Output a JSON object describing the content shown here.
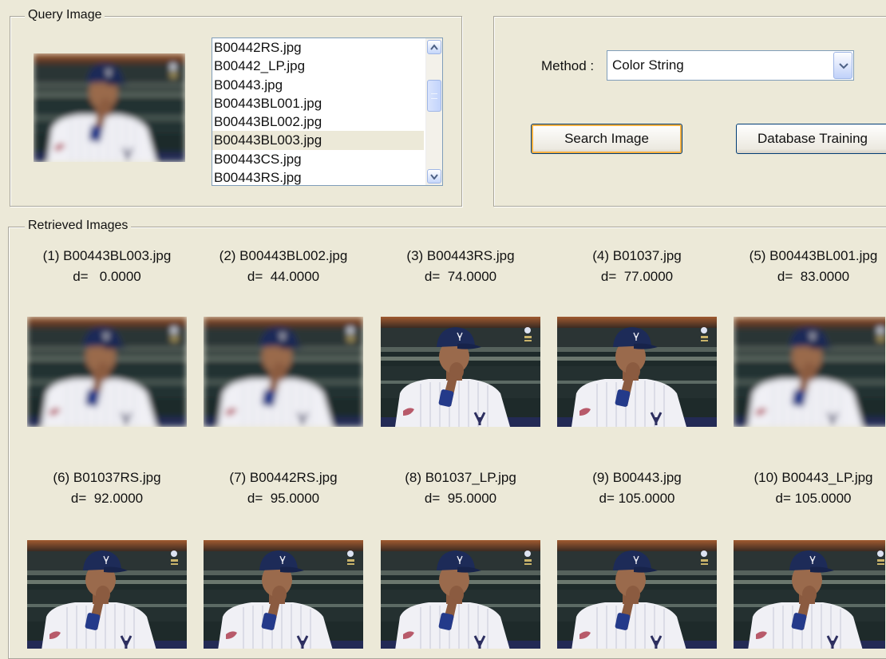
{
  "query_group": {
    "legend": "Query Image",
    "file_list": [
      "B00442RS.jpg",
      "B00442_LP.jpg",
      "B00443.jpg",
      "B00443BL001.jpg",
      "B00443BL002.jpg",
      "B00443BL003.jpg",
      "B00443CS.jpg",
      "B00443RS.jpg"
    ],
    "selected_file": "B00443BL003.jpg"
  },
  "controls": {
    "method_label": "Method :",
    "method_value": "Color String",
    "search_button": "Search Image",
    "training_button": "Database Training"
  },
  "results_group": {
    "legend": "Retrieved Images",
    "items": [
      {
        "title": "(1) B00443BL003.jpg",
        "distance": "d=   0.0000",
        "blurred": true
      },
      {
        "title": "(2) B00443BL002.jpg",
        "distance": "d=  44.0000",
        "blurred": true
      },
      {
        "title": "(3) B00443RS.jpg",
        "distance": "d=  74.0000",
        "blurred": false
      },
      {
        "title": "(4) B01037.jpg",
        "distance": "d=  77.0000",
        "blurred": false
      },
      {
        "title": "(5) B00443BL001.jpg",
        "distance": "d=  83.0000",
        "blurred": true
      },
      {
        "title": "(6) B01037RS.jpg",
        "distance": "d=  92.0000",
        "blurred": false
      },
      {
        "title": "(7) B00442RS.jpg",
        "distance": "d=  95.0000",
        "blurred": false
      },
      {
        "title": "(8) B01037_LP.jpg",
        "distance": "d=  95.0000",
        "blurred": false
      },
      {
        "title": "(9) B00443.jpg",
        "distance": "d= 105.0000",
        "blurred": false
      },
      {
        "title": "(10) B00443_LP.jpg",
        "distance": "d= 105.0000",
        "blurred": false
      }
    ]
  },
  "colors": {
    "window_bg": "#ece9d8",
    "group_border": "#a9a69b",
    "default_button_highlight": "#f8b040",
    "cap_navy": "#1d2b58",
    "jersey_white": "#f2f2f6"
  }
}
